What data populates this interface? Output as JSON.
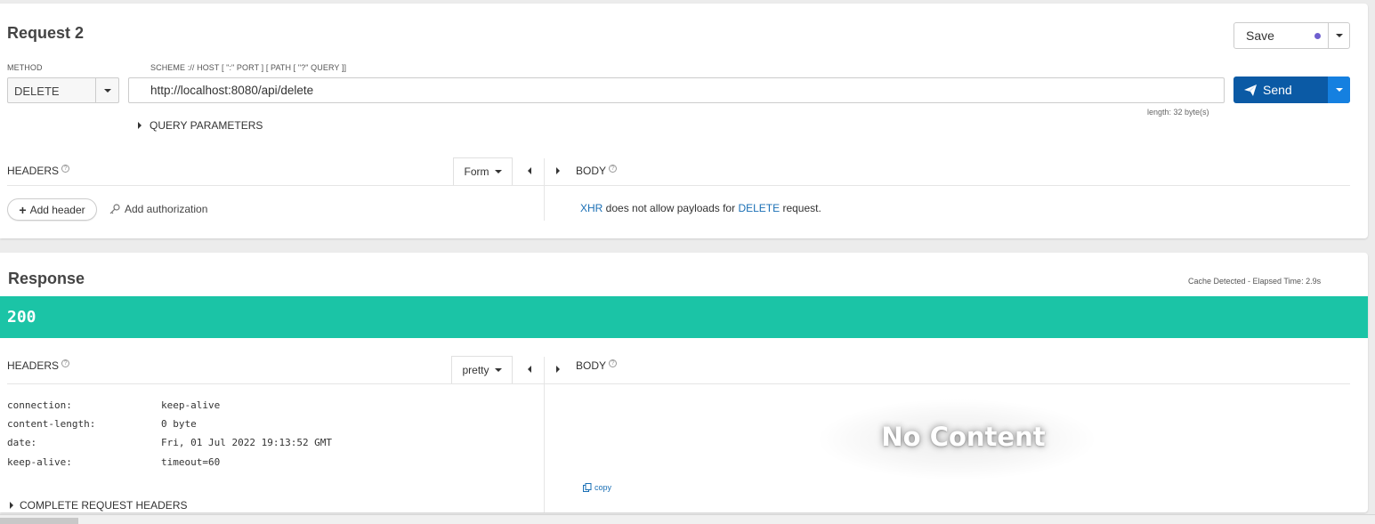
{
  "request": {
    "title": "Request 2",
    "save_label": "Save",
    "save_dot_color": "#6f5fcf",
    "method_label": "METHOD",
    "method_value": "DELETE",
    "url_hint": "SCHEME :// HOST [ \":\" PORT ] [ PATH [ \"?\" QUERY ]]",
    "url_value": "http://localhost:8080/api/delete",
    "send_label": "Send",
    "length_text": "length: 32 byte(s)",
    "query_params_label": "QUERY PARAMETERS",
    "headers_label": "HEADERS",
    "form_label": "Form",
    "body_label": "BODY",
    "add_header_label": "Add header",
    "add_auth_label": "Add authorization",
    "body_message": {
      "part1": "XHR",
      "part2": " does not allow payloads for ",
      "part3": "DELETE",
      "part4": " request."
    }
  },
  "response": {
    "title": "Response",
    "meta_text": "Cache Detected - Elapsed Time: 2.9s",
    "status_code": "200",
    "status_color": "#1bc4a6",
    "headers_label": "HEADERS",
    "pretty_label": "pretty",
    "body_label": "BODY",
    "headers": [
      {
        "name": "connection:",
        "value": "keep-alive"
      },
      {
        "name": "content-length:",
        "value": "0 byte"
      },
      {
        "name": "date:",
        "value": "Fri, 01 Jul 2022 19:13:52 GMT"
      },
      {
        "name": "keep-alive:",
        "value": "timeout=60"
      }
    ],
    "no_content_label": "No Content",
    "copy_label": "copy",
    "complete_headers_label": "COMPLETE REQUEST HEADERS"
  },
  "colors": {
    "send_primary": "#0b5aa5",
    "send_secondary": "#1580e0",
    "link": "#1a6fb5"
  }
}
